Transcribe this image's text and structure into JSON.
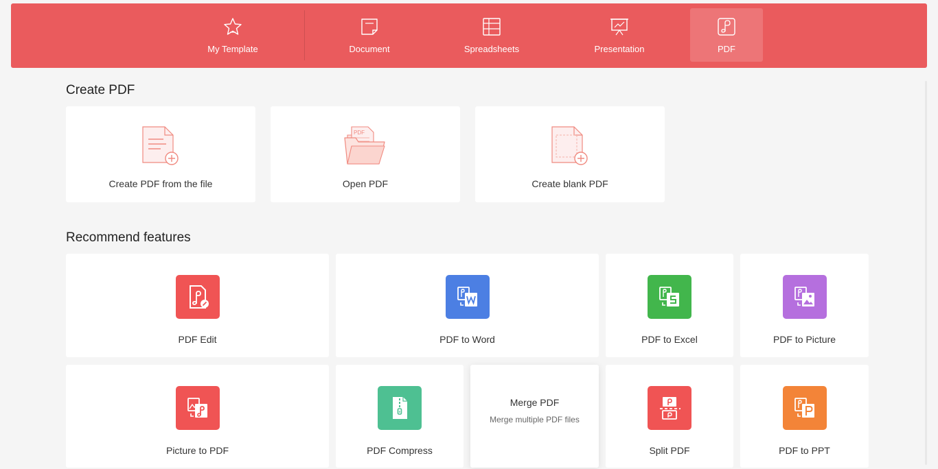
{
  "topbar": {
    "tabs": [
      {
        "label": "My Template"
      },
      {
        "label": "Document"
      },
      {
        "label": "Spreadsheets"
      },
      {
        "label": "Presentation"
      },
      {
        "label": "PDF"
      }
    ],
    "active_tab": "PDF",
    "color": "#ea5b5d"
  },
  "create_pdf": {
    "title": "Create PDF",
    "cards": [
      {
        "label": "Create PDF from the file",
        "icon": "file-add-icon"
      },
      {
        "label": "Open PDF",
        "icon": "folder-pdf-icon"
      },
      {
        "label": "Create blank PDF",
        "icon": "blank-file-add-icon"
      }
    ]
  },
  "recommend": {
    "title": "Recommend features",
    "features": [
      {
        "label": "PDF Edit",
        "color": "#f05454",
        "icon": "pdf-edit-icon"
      },
      {
        "label": "PDF to Word",
        "color": "#4c7fe3",
        "icon": "pdf-to-word-icon"
      },
      {
        "label": "PDF to Excel",
        "color": "#42b64c",
        "icon": "pdf-to-excel-icon"
      },
      {
        "label": "PDF to Picture",
        "color": "#b56fde",
        "icon": "pdf-to-picture-icon"
      },
      {
        "label": "Picture to PDF",
        "color": "#f05454",
        "icon": "picture-to-pdf-icon"
      },
      {
        "label": "PDF Compress",
        "color": "#4ec092",
        "icon": "pdf-compress-icon"
      },
      {
        "label": "Merge PDF",
        "subtitle": "Merge multiple PDF files"
      },
      {
        "label": "Split PDF",
        "color": "#f05454",
        "icon": "split-pdf-icon"
      },
      {
        "label": "PDF to PPT",
        "color": "#f38438",
        "icon": "pdf-to-ppt-icon"
      }
    ]
  }
}
